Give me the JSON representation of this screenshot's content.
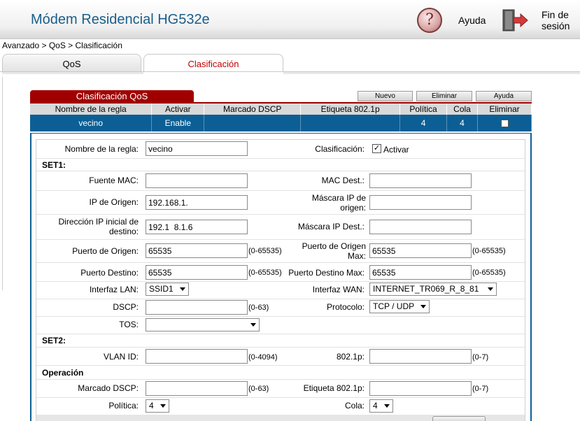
{
  "header": {
    "title": "Módem Residencial HG532e",
    "help_label": "Ayuda",
    "help_glyph": "?",
    "logout_label_1": "Fin de",
    "logout_label_2": "sesión"
  },
  "breadcrumb": "Avanzado > QoS > Clasificación",
  "tabs": [
    {
      "label": "QoS",
      "active": false
    },
    {
      "label": "Clasificación",
      "active": true
    }
  ],
  "section_title": "Clasificación QoS",
  "buttons": {
    "new": "Nuevo",
    "delete": "Eliminar",
    "help": "Ayuda"
  },
  "rules_table": {
    "headers": [
      "Nombre de la regla",
      "Activar",
      "Marcado DSCP",
      "Etiqueta 802.1p",
      "Política",
      "Cola",
      "Eliminar"
    ],
    "rows": [
      {
        "name": "vecino",
        "enable": "Enable",
        "dscp": "",
        "tag": "",
        "policy": "4",
        "queue": "4",
        "delete": false
      }
    ]
  },
  "form": {
    "rule_name_label": "Nombre de la regla:",
    "rule_name_value": "vecino",
    "classification_label": "Clasificación:",
    "activate_label": "Activar",
    "activate_checked": true,
    "set1_label": "SET1:",
    "src_mac_label": "Fuente MAC:",
    "src_mac_value": "",
    "dst_mac_label": "MAC Dest.:",
    "dst_mac_value": "",
    "src_ip_label": "IP de Origen:",
    "src_ip_value": "192.168.1.",
    "src_mask_label_1": "Máscara IP de",
    "src_mask_label_2": "origen:",
    "src_mask_value": "",
    "dst_ip_label_1": "Dirección IP inicial de",
    "dst_ip_label_2": "destino:",
    "dst_ip_value": "192.1  8.1.6",
    "dst_mask_label": "Máscara IP Dest.:",
    "dst_mask_value": "",
    "src_port_label": "Puerto de Origen:",
    "src_port_value": "65535",
    "src_port_range": "(0-65535)",
    "src_port_max_label_1": "Puerto de Origen",
    "src_port_max_label_2": "Max:",
    "src_port_max_value": "65535",
    "src_port_max_range": "(0-65535)",
    "dst_port_label": "Puerto Destino:",
    "dst_port_value": "65535",
    "dst_port_range": "(0-65535)",
    "dst_port_max_label": "Puerto Destino Max:",
    "dst_port_max_value": "65535",
    "dst_port_max_range": "(0-65535)",
    "lan_label": "Interfaz LAN:",
    "lan_value": "SSID1",
    "wan_label": "Interfaz WAN:",
    "wan_value": "INTERNET_TR069_R_8_81",
    "dscp_label": "DSCP:",
    "dscp_value": "",
    "dscp_range": "(0-63)",
    "protocol_label": "Protocolo:",
    "protocol_value": "TCP / UDP",
    "tos_label": "TOS:",
    "tos_value": "",
    "set2_label": "SET2:",
    "vlan_label": "VLAN ID:",
    "vlan_value": "",
    "vlan_range": "(0-4094)",
    "p8021_label": "802.1p:",
    "p8021_value": "",
    "p8021_range": "(0-7)",
    "op_label": "Operación",
    "mark_dscp_label": "Marcado DSCP:",
    "mark_dscp_value": "",
    "mark_dscp_range": "(0-63)",
    "tag_label": "Etiqueta 802.1p:",
    "tag_value": "",
    "tag_range": "(0-7)",
    "policy_label": "Política:",
    "policy_value": "4",
    "queue_label": "Cola:",
    "queue_value": "4"
  },
  "colors": {
    "brand_title": "#1a5e8a",
    "accent_red": "#a10000",
    "row_blue": "#0b5f95",
    "active_tab_text": "#c00000"
  }
}
